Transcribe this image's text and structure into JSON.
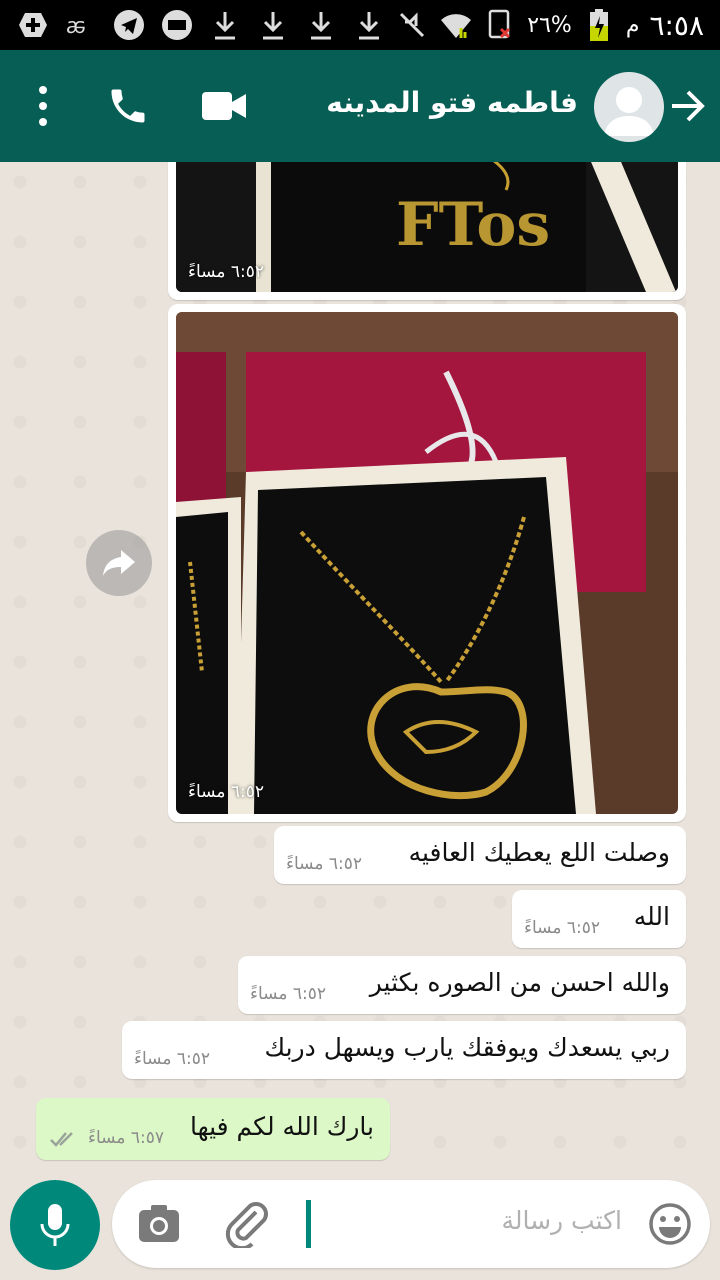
{
  "status_bar": {
    "time": "٦:٥٨",
    "am_pm": "م",
    "battery": "٢٦%",
    "icons": [
      "add-icon",
      "app-icon",
      "telegram-icon",
      "keyboard-icon",
      "download-icon",
      "download-icon",
      "download-icon",
      "download-icon",
      "mute-icon",
      "wifi-icon",
      "sim-icon",
      "battery-icon"
    ]
  },
  "header": {
    "contact_name": "فاطمه فتو المدينه",
    "icons": [
      "menu-icon",
      "call-icon",
      "video-call-icon",
      "avatar",
      "back-arrow-icon"
    ]
  },
  "messages": [
    {
      "type": "image",
      "time": "٦:٥٢ مساءً"
    },
    {
      "type": "image",
      "time": "٦:٥٢ مساءً"
    },
    {
      "type": "text",
      "text": "وصلت اللع يعطيك العافيه",
      "time": "٦:٥٢ مساءً"
    },
    {
      "type": "text",
      "text": "الله",
      "time": "٦:٥٢ مساءً"
    },
    {
      "type": "text",
      "text": "والله احسن من الصوره بكثير",
      "time": "٦:٥٢ مساءً"
    },
    {
      "type": "text",
      "text": "ربي يسعدك ويوفقك يارب ويسهل دربك",
      "time": "٦:٥٢ مساءً"
    },
    {
      "type": "text_out",
      "text": "بارك الله لكم فيها",
      "time": "٦:٥٧ مساءً"
    }
  ],
  "input": {
    "placeholder": "اكتب رسالة"
  },
  "colors": {
    "header": "#075e54",
    "accent": "#00897b",
    "outgoing_bubble": "#dcf8c6"
  }
}
